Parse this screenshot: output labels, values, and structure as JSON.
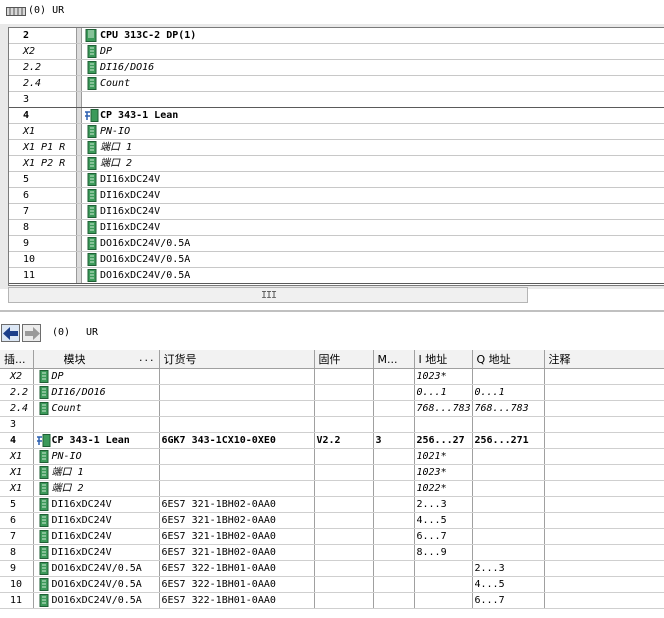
{
  "rack": {
    "number": "(0)",
    "title": "UR",
    "rows": [
      {
        "slot": "2",
        "module": "CPU 313C-2 DP(1)",
        "style": "bold",
        "icon": "cpu-icon"
      },
      {
        "slot": "X2",
        "module": "DP",
        "style": "italic",
        "icon": "none"
      },
      {
        "slot": "2.2",
        "module": "DI16/DO16",
        "style": "italic",
        "icon": "none"
      },
      {
        "slot": "2.4",
        "module": "Count",
        "style": "italic",
        "icon": "none"
      },
      {
        "slot": "3",
        "module": "",
        "style": "empty",
        "icon": "none"
      },
      {
        "slot": "4",
        "module": "CP 343-1 Lean",
        "style": "bold",
        "icon": "network-icon"
      },
      {
        "slot": "X1",
        "module": "PN-IO",
        "style": "italic",
        "icon": "none"
      },
      {
        "slot": "X1 P1 R",
        "module": "端口 1",
        "style": "italic",
        "icon": "none"
      },
      {
        "slot": "X1 P2 R",
        "module": "端口 2",
        "style": "italic",
        "icon": "none"
      },
      {
        "slot": "5",
        "module": "DI16xDC24V",
        "style": "normal",
        "icon": "none"
      },
      {
        "slot": "6",
        "module": "DI16xDC24V",
        "style": "normal",
        "icon": "none"
      },
      {
        "slot": "7",
        "module": "DI16xDC24V",
        "style": "normal",
        "icon": "none"
      },
      {
        "slot": "8",
        "module": "DI16xDC24V",
        "style": "normal",
        "icon": "none"
      },
      {
        "slot": "9",
        "module": "DO16xDC24V/0.5A",
        "style": "normal",
        "icon": "none"
      },
      {
        "slot": "10",
        "module": "DO16xDC24V/0.5A",
        "style": "normal",
        "icon": "none"
      },
      {
        "slot": "11",
        "module": "DO16xDC24V/0.5A",
        "style": "normal",
        "icon": "none"
      }
    ]
  },
  "scrollbar": {
    "grip": "III"
  },
  "detail": {
    "number": "(0)",
    "title": "UR",
    "columns": [
      "插...",
      "模块",
      "订货号",
      "固件",
      "M...",
      "I 地址",
      "Q 地址",
      "注释"
    ],
    "module_sort_marker": "...",
    "rows": [
      {
        "slot": "X2",
        "module": "DP",
        "order": "",
        "fw": "",
        "m": "",
        "i": "1023*",
        "q": "",
        "comment": "",
        "style": "italic"
      },
      {
        "slot": "2.2",
        "module": "DI16/DO16",
        "order": "",
        "fw": "",
        "m": "",
        "i": "0...1",
        "q": "0...1",
        "comment": "",
        "style": "italic"
      },
      {
        "slot": "2.4",
        "module": "Count",
        "order": "",
        "fw": "",
        "m": "",
        "i": "768...783",
        "q": "768...783",
        "comment": "",
        "style": "italic"
      },
      {
        "slot": "3",
        "module": "",
        "order": "",
        "fw": "",
        "m": "",
        "i": "",
        "q": "",
        "comment": "",
        "style": "empty"
      },
      {
        "slot": "4",
        "module": "CP 343-1 Lean",
        "order": "6GK7 343-1CX10-0XE0",
        "fw": "V2.2",
        "m": "3",
        "i": "256...27",
        "q": "256...271",
        "comment": "",
        "style": "bold"
      },
      {
        "slot": "X1",
        "module": "PN-IO",
        "order": "",
        "fw": "",
        "m": "",
        "i": "1021*",
        "q": "",
        "comment": "",
        "style": "italic"
      },
      {
        "slot": "X1",
        "module": "端口 1",
        "order": "",
        "fw": "",
        "m": "",
        "i": "1023*",
        "q": "",
        "comment": "",
        "style": "italic"
      },
      {
        "slot": "X1",
        "module": "端口 2",
        "order": "",
        "fw": "",
        "m": "",
        "i": "1022*",
        "q": "",
        "comment": "",
        "style": "italic"
      },
      {
        "slot": "5",
        "module": "DI16xDC24V",
        "order": "6ES7 321-1BH02-0AA0",
        "fw": "",
        "m": "",
        "i": "2...3",
        "q": "",
        "comment": "",
        "style": "normal"
      },
      {
        "slot": "6",
        "module": "DI16xDC24V",
        "order": "6ES7 321-1BH02-0AA0",
        "fw": "",
        "m": "",
        "i": "4...5",
        "q": "",
        "comment": "",
        "style": "normal"
      },
      {
        "slot": "7",
        "module": "DI16xDC24V",
        "order": "6ES7 321-1BH02-0AA0",
        "fw": "",
        "m": "",
        "i": "6...7",
        "q": "",
        "comment": "",
        "style": "normal"
      },
      {
        "slot": "8",
        "module": "DI16xDC24V",
        "order": "6ES7 321-1BH02-0AA0",
        "fw": "",
        "m": "",
        "i": "8...9",
        "q": "",
        "comment": "",
        "style": "normal"
      },
      {
        "slot": "9",
        "module": "DO16xDC24V/0.5A",
        "order": "6ES7 322-1BH01-0AA0",
        "fw": "",
        "m": "",
        "i": "",
        "q": "2...3",
        "comment": "",
        "style": "normal"
      },
      {
        "slot": "10",
        "module": "DO16xDC24V/0.5A",
        "order": "6ES7 322-1BH01-0AA0",
        "fw": "",
        "m": "",
        "i": "",
        "q": "4...5",
        "comment": "",
        "style": "normal"
      },
      {
        "slot": "11",
        "module": "DO16xDC24V/0.5A",
        "order": "6ES7 322-1BH01-0AA0",
        "fw": "",
        "m": "",
        "i": "",
        "q": "6...7",
        "comment": "",
        "style": "normal"
      }
    ]
  },
  "colors": {
    "module_green": "#3c9a5a",
    "network_blue": "#2a5fb0",
    "back_arrow": "#1c3f8a"
  }
}
